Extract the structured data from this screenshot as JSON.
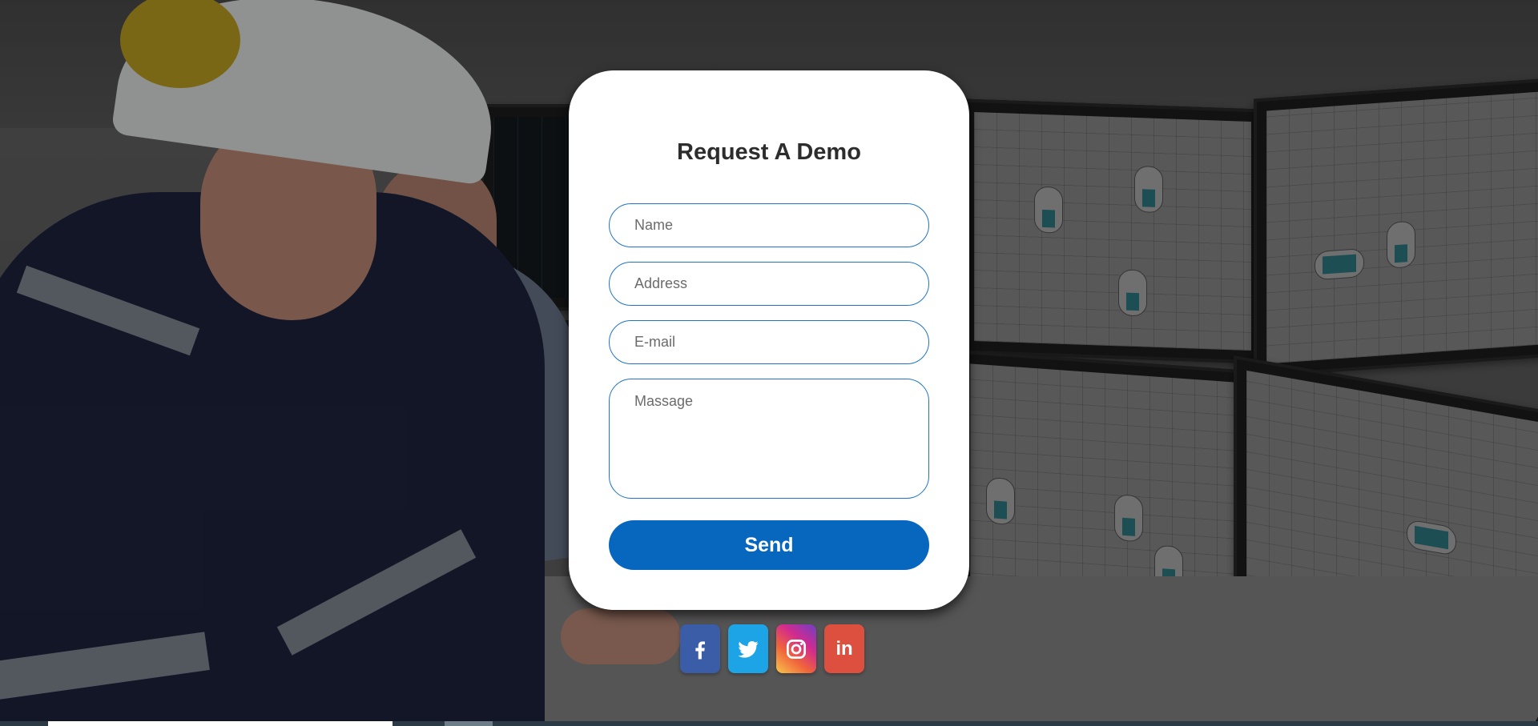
{
  "form": {
    "title": "Request A Demo",
    "name_placeholder": "Name",
    "address_placeholder": "Address",
    "email_placeholder": "E-mail",
    "message_placeholder": "Massage",
    "send_label": "Send"
  },
  "social": {
    "facebook_icon": "facebook-icon",
    "twitter_icon": "twitter-icon",
    "instagram_icon": "instagram-icon",
    "linkedin_label": "in"
  },
  "colors": {
    "accent": "#0767bf",
    "field_border": "#1f74c4",
    "facebook": "#3b5ca6",
    "twitter": "#1da4e6",
    "linkedin": "#dd5040"
  }
}
